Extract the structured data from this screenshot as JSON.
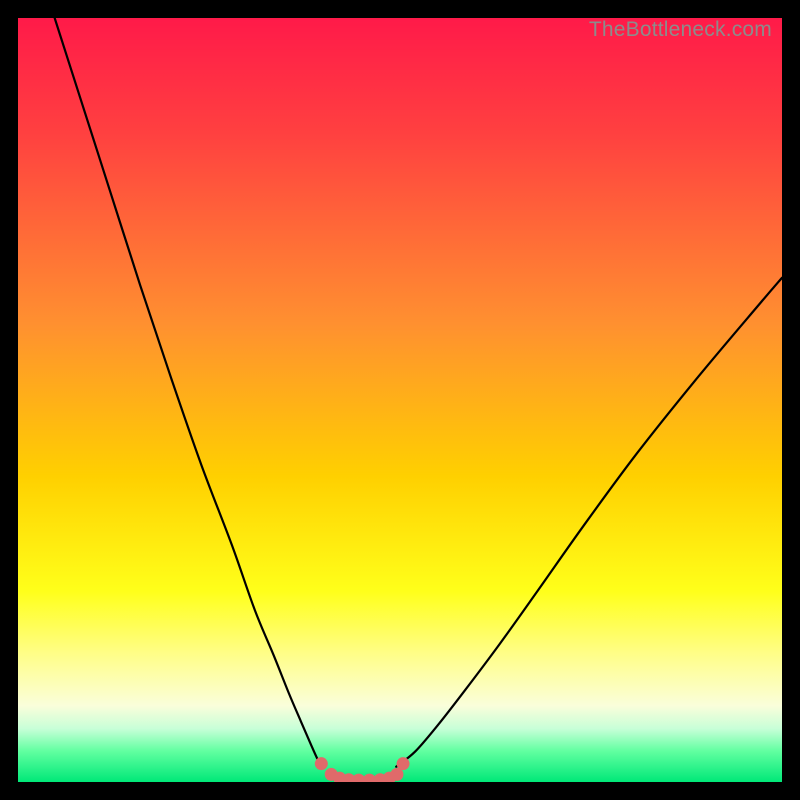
{
  "watermark": "TheBottleneck.com",
  "chart_data": {
    "type": "line",
    "title": "",
    "xlabel": "",
    "ylabel": "",
    "xlim": [
      0,
      100
    ],
    "ylim": [
      0,
      100
    ],
    "grid": false,
    "legend": false,
    "background_gradient": {
      "stops": [
        {
          "offset": 0.0,
          "color": "#ff1a49"
        },
        {
          "offset": 0.15,
          "color": "#ff4040"
        },
        {
          "offset": 0.4,
          "color": "#ff9030"
        },
        {
          "offset": 0.6,
          "color": "#ffd000"
        },
        {
          "offset": 0.75,
          "color": "#ffff1a"
        },
        {
          "offset": 0.83,
          "color": "#fffe85"
        },
        {
          "offset": 0.9,
          "color": "#fafeda"
        },
        {
          "offset": 0.93,
          "color": "#c8ffd8"
        },
        {
          "offset": 0.96,
          "color": "#60ffa0"
        },
        {
          "offset": 1.0,
          "color": "#00e878"
        }
      ]
    },
    "series": [
      {
        "name": "left-curve",
        "stroke": "#000000",
        "stroke_width": 2.2,
        "x": [
          4.8,
          8,
          12,
          16,
          20,
          24,
          28,
          31,
          33.5,
          35.5,
          37,
          38.3,
          39.2,
          39.8
        ],
        "y": [
          100,
          90,
          77.5,
          65,
          53,
          41.5,
          31,
          22.5,
          16.5,
          11.5,
          8,
          5,
          3,
          2
        ]
      },
      {
        "name": "right-curve",
        "stroke": "#000000",
        "stroke_width": 2.2,
        "x": [
          49.5,
          52,
          55,
          58.5,
          63,
          68,
          74,
          81,
          89,
          97,
          100
        ],
        "y": [
          2,
          4,
          7.5,
          12,
          18,
          25,
          33.5,
          43,
          53,
          62.5,
          66
        ]
      },
      {
        "name": "bottom-dots",
        "type": "scatter",
        "color": "#e06a6a",
        "radius": 6.5,
        "x": [
          39.7,
          41.0,
          42.1,
          43.3,
          44.6,
          46.0,
          47.4,
          48.6,
          49.6,
          50.4
        ],
        "y": [
          2.4,
          1.0,
          0.5,
          0.3,
          0.25,
          0.25,
          0.3,
          0.5,
          1.0,
          2.4
        ]
      }
    ]
  }
}
